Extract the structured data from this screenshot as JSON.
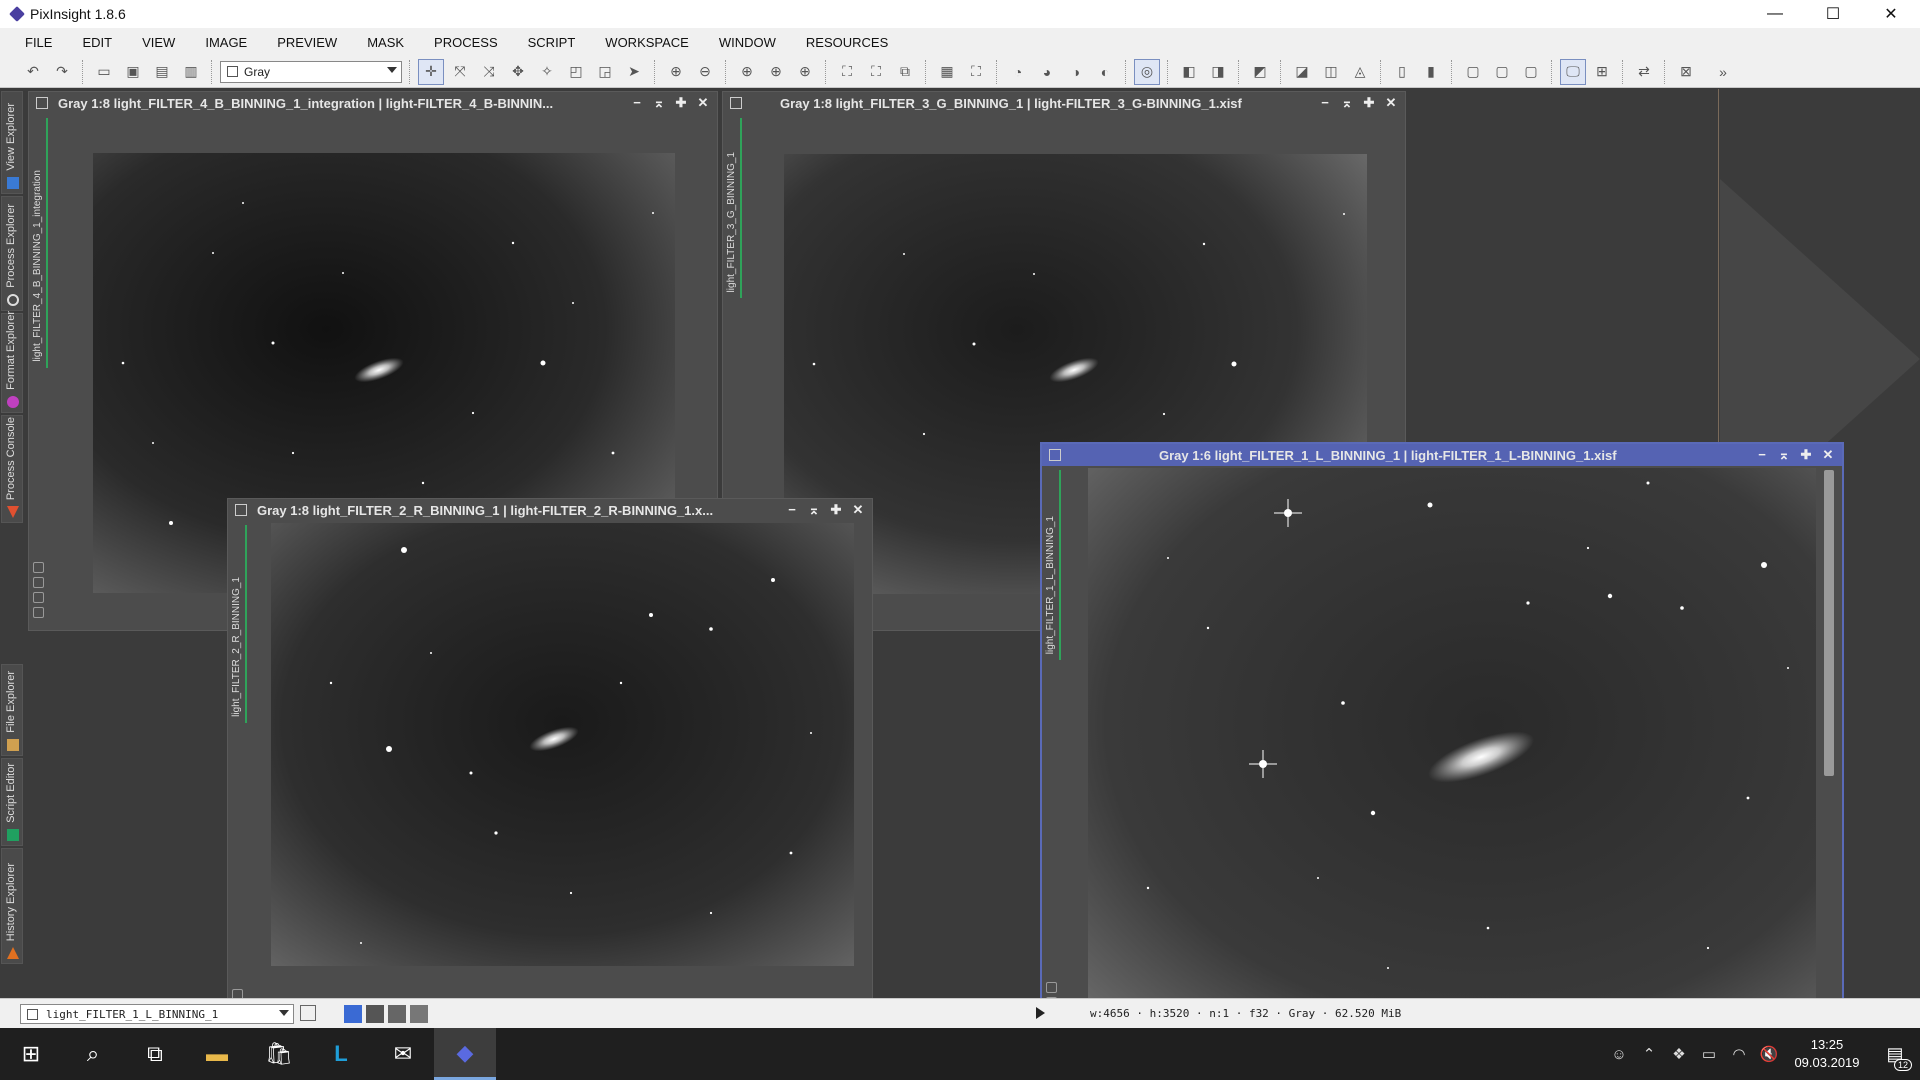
{
  "app": {
    "title": "PixInsight 1.8.6",
    "controls": {
      "minimize": "—",
      "maximize": "☐",
      "close": "✕"
    }
  },
  "menu": [
    "FILE",
    "EDIT",
    "VIEW",
    "IMAGE",
    "PREVIEW",
    "MASK",
    "PROCESS",
    "SCRIPT",
    "WORKSPACE",
    "WINDOW",
    "RESOURCES"
  ],
  "toolbar": {
    "color_mode_select": "Gray"
  },
  "side_tabs": [
    {
      "label": "View Explorer",
      "icon": "view-explorer-icon",
      "color": "#3a7ad4"
    },
    {
      "label": "Process Explorer",
      "icon": "gear-icon",
      "color": "#cccccc"
    },
    {
      "label": "Format Explorer",
      "icon": "format-explorer-icon",
      "color": "#c040c0"
    },
    {
      "label": "Process Console",
      "icon": "console-icon",
      "color": "#e05030"
    },
    {
      "label": "File Explorer",
      "icon": "file-explorer-icon",
      "color": "#d0a050"
    },
    {
      "label": "Script Editor",
      "icon": "script-editor-icon",
      "color": "#20a060"
    },
    {
      "label": "History Explorer",
      "icon": "history-icon",
      "color": "#e07020"
    }
  ],
  "image_windows": [
    {
      "title": "Gray 1:8 light_FILTER_4_B_BINNING_1_integration | light-FILTER_4_B-BINNIN...",
      "view_id": "light_FILTER_4_B_BINNING_1_integration",
      "active": false
    },
    {
      "title": "Gray 1:8 light_FILTER_3_G_BINNING_1 | light-FILTER_3_G-BINNING_1.xisf",
      "view_id": "light_FILTER_3_G_BINNING_1",
      "active": false
    },
    {
      "title": "Gray 1:8 light_FILTER_2_R_BINNING_1 | light-FILTER_2_R-BINNING_1.x...",
      "view_id": "light_FILTER_2_R_BINNING_1",
      "active": false
    },
    {
      "title": "Gray 1:6 light_FILTER_1_L_BINNING_1 | light-FILTER_1_L-BINNING_1.xisf",
      "view_id": "light_FILTER_1_L_BINNING_1",
      "active": true
    }
  ],
  "statusbar": {
    "view_select": "light_FILTER_1_L_BINNING_1",
    "info": "w:4656 · h:3520 · n:1 · f32 · Gray · 62.520 MiB"
  },
  "taskbar": {
    "time": "13:25",
    "date": "09.03.2019",
    "notifications": "12"
  }
}
